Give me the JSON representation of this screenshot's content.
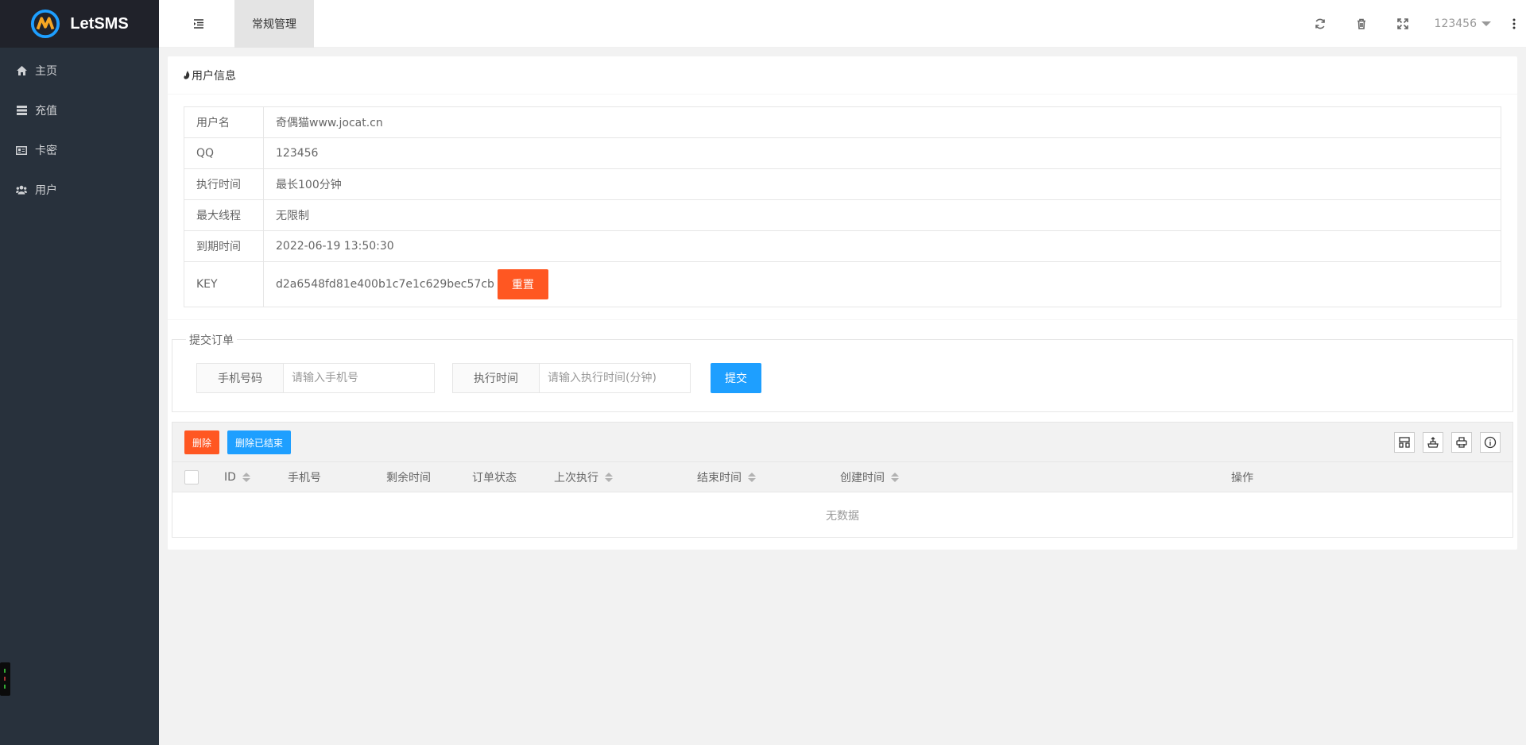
{
  "app": {
    "name": "LetSMS"
  },
  "sidebar": {
    "items": [
      {
        "label": "主页",
        "icon": "home-icon"
      },
      {
        "label": "充值",
        "icon": "server-icon"
      },
      {
        "label": "卡密",
        "icon": "id-card-icon"
      },
      {
        "label": "用户",
        "icon": "users-icon"
      }
    ]
  },
  "header": {
    "tab": "常规管理",
    "user": "123456",
    "icons": [
      "menu-toggle-icon",
      "refresh-icon",
      "trash-icon",
      "fullscreen-icon",
      "more-icon"
    ]
  },
  "user_info": {
    "title": "用户信息",
    "rows": [
      {
        "label": "用户名",
        "value": "奇偶猫www.jocat.cn"
      },
      {
        "label": "QQ",
        "value": "123456"
      },
      {
        "label": "执行时间",
        "value": "最长100分钟"
      },
      {
        "label": "最大线程",
        "value": "无限制"
      },
      {
        "label": "到期时间",
        "value": "2022-06-19 13:50:30"
      },
      {
        "label": "KEY",
        "value": "d2a6548fd81e400b1c7e1c629bec57cb"
      }
    ],
    "reset_label": "重置"
  },
  "order_form": {
    "legend": "提交订单",
    "phone_label": "手机号码",
    "phone_placeholder": "请输入手机号",
    "time_label": "执行时间",
    "time_placeholder": "请输入执行时间(分钟)",
    "submit_label": "提交"
  },
  "orders_table": {
    "delete_label": "删除",
    "delete_finished_label": "删除已结束",
    "columns": [
      "ID",
      "手机号",
      "剩余时间",
      "订单状态",
      "上次执行",
      "结束时间",
      "创建时间",
      "操作"
    ],
    "empty_text": "无数据",
    "tool_icons": [
      "columns-icon",
      "export-icon",
      "print-icon",
      "info-icon"
    ]
  },
  "colors": {
    "sidebar_bg": "#28313c",
    "logo_bg": "#20222a",
    "danger": "#ff5722",
    "primary": "#1e9fff",
    "page_bg": "#f2f2f2"
  }
}
